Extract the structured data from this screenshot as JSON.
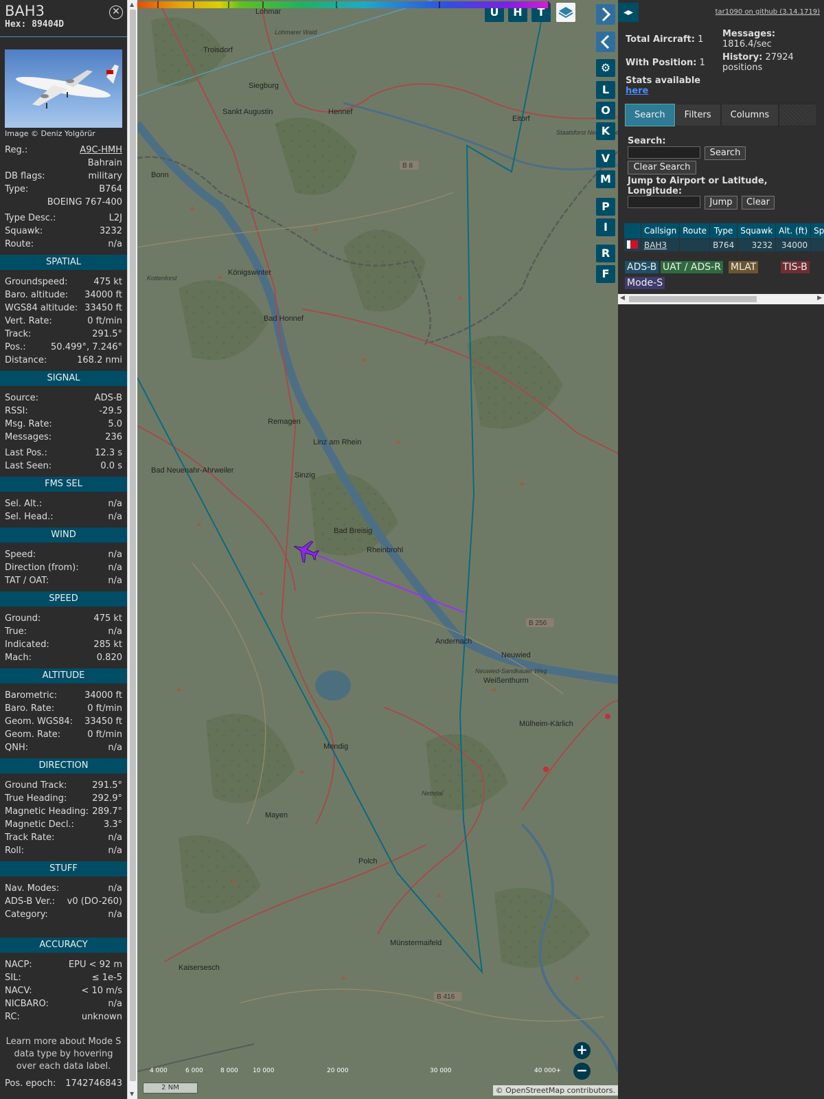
{
  "infoblock": {
    "callsign": "BAH3",
    "hex": "Hex: 89404D",
    "close_icon": "circle-x-icon",
    "photo_credit": "Image © Deniz Yolgörür",
    "basic": [
      {
        "label": "Reg.:",
        "value": "A9C-HMH",
        "link": true
      },
      {
        "label": "",
        "value": "Bahrain"
      },
      {
        "label": "DB flags:",
        "value": "military"
      },
      {
        "label": "Type:",
        "value": "B764"
      },
      {
        "label": "",
        "value": "BOEING 767-400"
      },
      {
        "label": "Type Desc.:",
        "value": "L2J",
        "gap": true
      },
      {
        "label": "Squawk:",
        "value": "3232"
      },
      {
        "label": "Route:",
        "value": "n/a"
      }
    ],
    "sections": [
      {
        "title": "SPATIAL",
        "rows": [
          {
            "label": "Groundspeed:",
            "value": "475 kt"
          },
          {
            "label": "Baro. altitude:",
            "value": "34000 ft"
          },
          {
            "label": "WGS84 altitude:",
            "value": "33450 ft"
          },
          {
            "label": "Vert. Rate:",
            "value": "0 ft/min"
          },
          {
            "label": "Track:",
            "value": "291.5°"
          },
          {
            "label": "Pos.:",
            "value": "50.499°, 7.246°"
          },
          {
            "label": "Distance:",
            "value": "168.2 nmi"
          }
        ]
      },
      {
        "title": "SIGNAL",
        "rows": [
          {
            "label": "Source:",
            "value": "ADS-B"
          },
          {
            "label": "RSSI:",
            "value": "-29.5"
          },
          {
            "label": "Msg. Rate:",
            "value": "5.0"
          },
          {
            "label": "Messages:",
            "value": "236"
          },
          {
            "label": "Last Pos.:",
            "value": "12.3 s",
            "gap": true
          },
          {
            "label": "Last Seen:",
            "value": "0.0 s"
          }
        ]
      },
      {
        "title": "FMS SEL",
        "rows": [
          {
            "label": "Sel. Alt.:",
            "value": "n/a"
          },
          {
            "label": "Sel. Head.:",
            "value": "n/a"
          }
        ]
      },
      {
        "title": "WIND",
        "rows": [
          {
            "label": "Speed:",
            "value": "n/a"
          },
          {
            "label": "Direction (from):",
            "value": "n/a"
          },
          {
            "label": "TAT / OAT:",
            "value": "n/a"
          }
        ]
      },
      {
        "title": "SPEED",
        "rows": [
          {
            "label": "Ground:",
            "value": "475 kt"
          },
          {
            "label": "True:",
            "value": "n/a"
          },
          {
            "label": "Indicated:",
            "value": "285 kt"
          },
          {
            "label": "Mach:",
            "value": "0.820"
          }
        ]
      },
      {
        "title": "ALTITUDE",
        "rows": [
          {
            "label": "Barometric:",
            "value": "34000 ft"
          },
          {
            "label": "Baro. Rate:",
            "value": "0 ft/min"
          },
          {
            "label": "Geom. WGS84:",
            "value": "33450 ft"
          },
          {
            "label": "Geom. Rate:",
            "value": "0 ft/min"
          },
          {
            "label": "QNH:",
            "value": "n/a"
          }
        ]
      },
      {
        "title": "DIRECTION",
        "rows": [
          {
            "label": "Ground Track:",
            "value": "291.5°"
          },
          {
            "label": "True Heading:",
            "value": "292.9°"
          },
          {
            "label": "Magnetic Heading:",
            "value": "289.7°"
          },
          {
            "label": "Magnetic Decl.:",
            "value": "3.3°"
          },
          {
            "label": "Track Rate:",
            "value": "n/a"
          },
          {
            "label": "Roll:",
            "value": "n/a"
          }
        ]
      },
      {
        "title": "STUFF",
        "rows": [
          {
            "label": "Nav. Modes:",
            "value": "n/a"
          },
          {
            "label": "ADS-B Ver.:",
            "value": "v0 (DO-260)"
          },
          {
            "label": "Category:",
            "value": "n/a"
          }
        ]
      },
      {
        "title": "ACCURACY",
        "gap_before": true,
        "rows": [
          {
            "label": "NACP:",
            "value": "EPU < 92 m"
          },
          {
            "label": "SIL:",
            "value": "≤ 1e-5"
          },
          {
            "label": "NACV:",
            "value": "< 10 m/s"
          },
          {
            "label": "NICBARO:",
            "value": "n/a"
          },
          {
            "label": "RC:",
            "value": "unknown"
          }
        ]
      }
    ],
    "footer_note": "Learn more about Mode S data type by hovering over each data label.",
    "pos_epoch_label": "Pos. epoch:",
    "pos_epoch_value": "1742746843"
  },
  "map": {
    "top_buttons": [
      "U",
      "H",
      "T"
    ],
    "layers_icon": "layers-icon",
    "nav_next_icon": "chevron-right-icon",
    "nav_prev_icon": "chevron-left-icon",
    "settings_icon": "gear-icon",
    "side_buttons": [
      "L",
      "O",
      "K",
      "V",
      "M",
      "P",
      "I",
      "R",
      "F"
    ],
    "places": [
      {
        "name": "Lohmar"
      },
      {
        "name": "Troisdorf"
      },
      {
        "name": "Siegburg"
      },
      {
        "name": "Sankt Augustin"
      },
      {
        "name": "Hennef"
      },
      {
        "name": "Eitorf"
      },
      {
        "name": "Bonn"
      },
      {
        "name": "Königswinter"
      },
      {
        "name": "Bad Honnef"
      },
      {
        "name": "Remagen"
      },
      {
        "name": "Linz am Rhein"
      },
      {
        "name": "Bad Neuenahr-Ahrweiler"
      },
      {
        "name": "Sinzig"
      },
      {
        "name": "Bad Breisig"
      },
      {
        "name": "Rheinbrohl"
      },
      {
        "name": "Andernach"
      },
      {
        "name": "Neuwied"
      },
      {
        "name": "Weißenthurm"
      },
      {
        "name": "Mülheim-Kärlich"
      },
      {
        "name": "Mendig"
      },
      {
        "name": "Mayen"
      },
      {
        "name": "Polch"
      },
      {
        "name": "Münstermaifeld"
      },
      {
        "name": "Kaisersesch"
      },
      {
        "name": "Staatsforst Neunkirchen-Seelscheid"
      },
      {
        "name": "Lohmarer Wald"
      },
      {
        "name": "Kottenforst"
      },
      {
        "name": "Nettetal"
      },
      {
        "name": "Neuwied-Sandkauler Weg"
      }
    ],
    "road_labels": [
      "B 8",
      "B 256",
      "B 416"
    ],
    "alt_legend": [
      "4 000",
      "6 000",
      "8 000",
      "10 000",
      "20 000",
      "30 000",
      "40 000+"
    ],
    "scale": "2 NM",
    "attribution": "© OpenStreetMap contributors.",
    "zoom_in": "+",
    "zoom_out": "−",
    "track_color": "#9a30ff",
    "trace_color": "#0b6a80"
  },
  "panel": {
    "github_link": "tar1090 on github (3.14.1719)",
    "total_label": "Total Aircraft:",
    "total_value": "1",
    "with_pos_label": "With Position:",
    "with_pos_value": "1",
    "stats_label": "Stats available",
    "stats_link": "here",
    "messages_label": "Messages:",
    "messages_value": "1816.4/sec",
    "history_label": "History:",
    "history_value": "27924 positions",
    "tabs": [
      "Search",
      "Filters",
      "Columns"
    ],
    "search_label": "Search:",
    "search_button": "Search",
    "clear_search_button": "Clear Search",
    "jump_label": "Jump to Airport or Latitude, Longitude:",
    "jump_button": "Jump",
    "clear_button": "Clear",
    "columns": [
      "",
      "Callsign",
      "Route",
      "Type",
      "Squawk",
      "Alt. (ft)",
      "Spd."
    ],
    "rows": [
      {
        "callsign": "BAH3",
        "route": "",
        "type": "B764",
        "squawk": "3232",
        "alt": "34000",
        "spd": ""
      }
    ],
    "legend": [
      {
        "label": "ADS-B",
        "color": "#1f4f66"
      },
      {
        "label": "UAT / ADS-R",
        "color": "#2f6a3f"
      },
      {
        "label": "MLAT",
        "color": "#6a5632"
      },
      {
        "label": "TIS-B",
        "color": "#6e2f34"
      },
      {
        "label": "Mode-S",
        "color": "#3f3b6b"
      }
    ]
  }
}
